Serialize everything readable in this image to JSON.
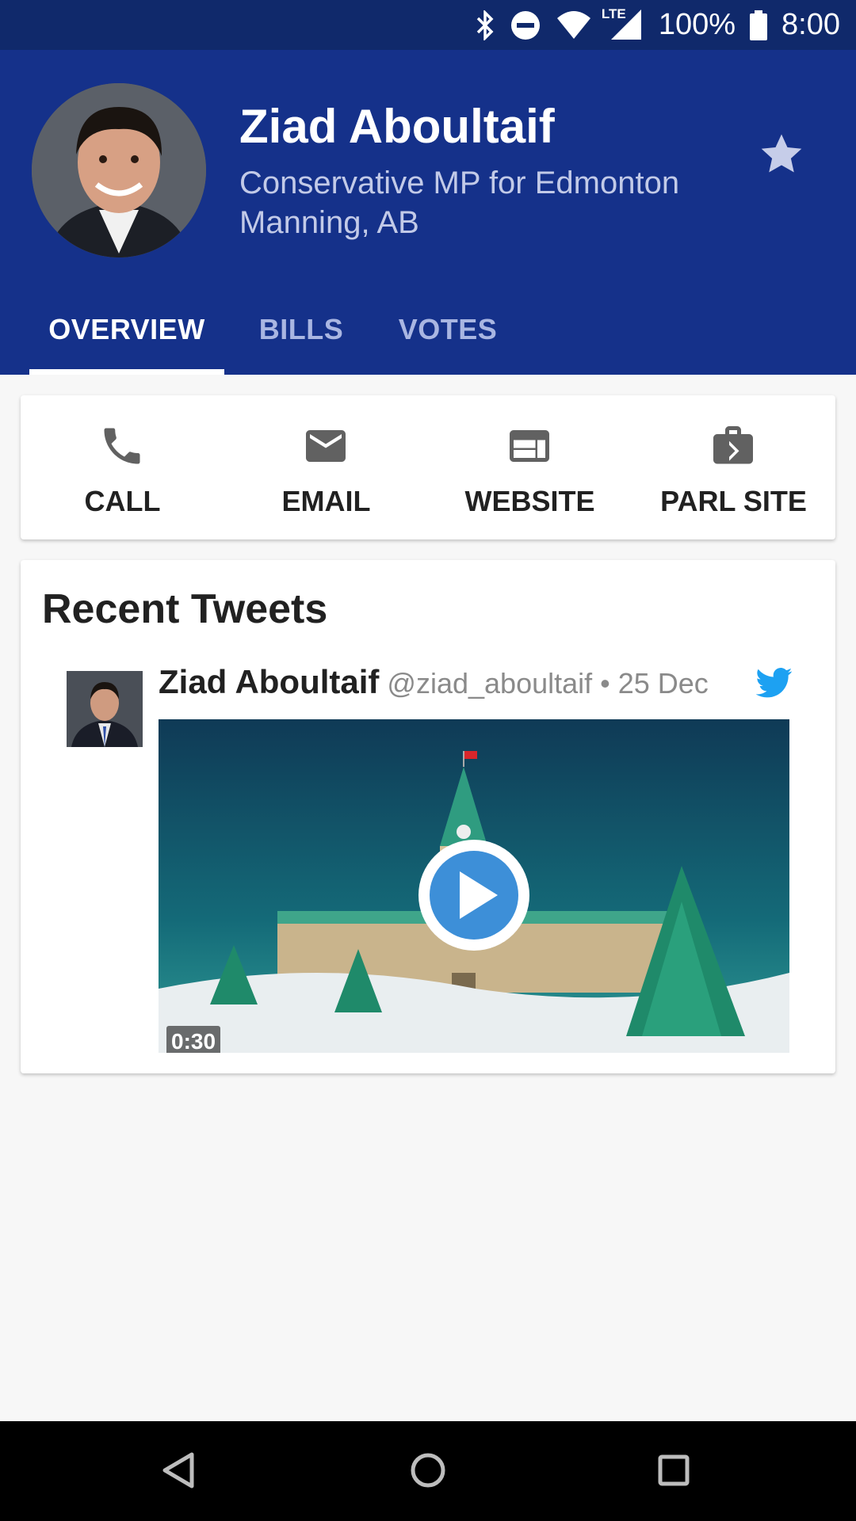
{
  "status_bar": {
    "network": "LTE",
    "battery": "100%",
    "time": "8:00",
    "icons": [
      "bluetooth-icon",
      "do-not-disturb-icon",
      "wifi-icon",
      "cell-signal-icon",
      "battery-icon"
    ]
  },
  "profile": {
    "name": "Ziad Aboultaif",
    "subtitle": "Conservative MP for Edmonton Manning, AB",
    "favorite_icon": "star-icon"
  },
  "tabs": [
    {
      "label": "OVERVIEW",
      "active": true
    },
    {
      "label": "BILLS",
      "active": false
    },
    {
      "label": "VOTES",
      "active": false
    }
  ],
  "actions": [
    {
      "label": "CALL",
      "icon": "phone-icon"
    },
    {
      "label": "EMAIL",
      "icon": "mail-icon"
    },
    {
      "label": "WEBSITE",
      "icon": "web-icon"
    },
    {
      "label": "PARL SITE",
      "icon": "briefcase-icon"
    }
  ],
  "recent_tweets": {
    "title": "Recent Tweets",
    "tweets": [
      {
        "author": "Ziad Aboultaif",
        "handle": "@ziad_aboultaif",
        "date": "• 25 Dec",
        "media_duration": "0:30"
      }
    ]
  },
  "colors": {
    "header": "#15318a",
    "status_bar": "#10296b",
    "twitter_blue": "#1da1f2",
    "background": "#f7f7f7"
  }
}
